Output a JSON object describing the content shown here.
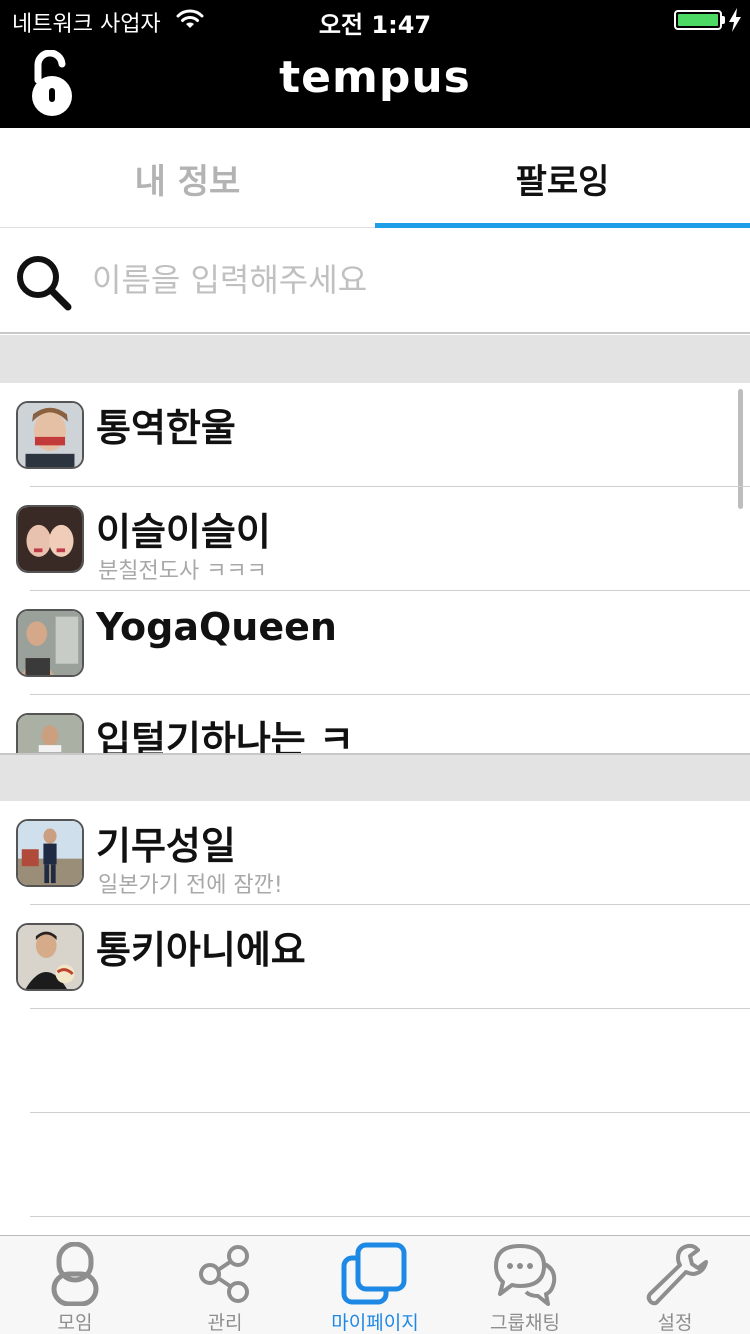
{
  "status_bar": {
    "carrier": "네트워크 사업자",
    "time": "오전 1:47",
    "battery_level": 1.0
  },
  "nav": {
    "title": "tempus",
    "left_icon": "unlock-icon"
  },
  "tabs": [
    {
      "label": "내 정보",
      "active": false
    },
    {
      "label": "팔로잉",
      "active": true
    }
  ],
  "search": {
    "placeholder": "이름을 입력해주세요",
    "value": ""
  },
  "sections": [
    {
      "rows": [
        {
          "name": "통역한울",
          "status": ""
        },
        {
          "name": "이슬이슬이",
          "status": "분칠전도사 ㅋㅋㅋ"
        },
        {
          "name": "YogaQueen",
          "status": ""
        },
        {
          "name": "입털기하나는 ㅋ",
          "status": ""
        }
      ]
    },
    {
      "rows": [
        {
          "name": "기무성일",
          "status": "일본가기 전에 잠깐!"
        },
        {
          "name": "통키아니에요",
          "status": ""
        }
      ]
    }
  ],
  "tab_bar": [
    {
      "label": "모임",
      "icon": "person-icon",
      "active": false
    },
    {
      "label": "관리",
      "icon": "share-icon",
      "active": false
    },
    {
      "label": "마이페이지",
      "icon": "squares-icon",
      "active": true
    },
    {
      "label": "그룹채팅",
      "icon": "chat-bubbles-icon",
      "active": false
    },
    {
      "label": "설정",
      "icon": "wrench-icon",
      "active": false
    }
  ],
  "colors": {
    "accent": "#1e9ee6",
    "active_tab": "#1e88e5",
    "inactive_tab": "#8e8e8e",
    "header_bg": "#000000"
  }
}
